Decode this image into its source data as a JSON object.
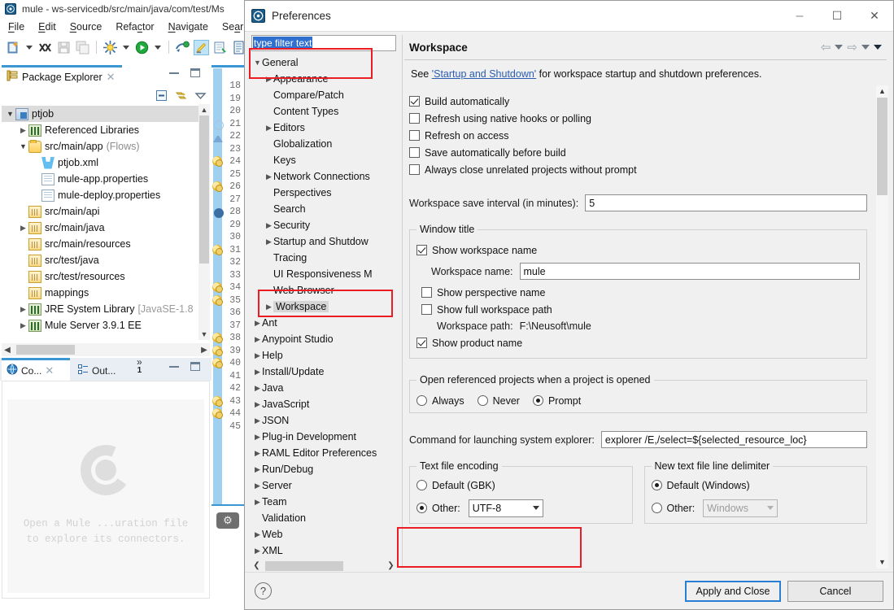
{
  "eclipse": {
    "window_title": "mule - ws-servicedb/src/main/java/com/test/Ms",
    "menu": [
      "File",
      "Edit",
      "Source",
      "Refactor",
      "Navigate",
      "Search"
    ],
    "toolbar_icons": [
      "new-wizard-icon",
      "new-wizard-dropdown",
      "link-break-icon",
      "save-icon",
      "save-all-icon",
      "debug-icon",
      "debug-dropdown",
      "run-icon",
      "run-dropdown",
      "mule-deploy-icon",
      "highlight-icon",
      "external-tools-icon",
      "open-task-icon"
    ],
    "package_explorer": {
      "tab_label": "Package Explorer",
      "tab_icon": "package-explorer-icon",
      "close_icon": "close-icon",
      "view_icons": [
        "collapse-all-icon",
        "link-with-editor-icon",
        "view-menu-icon"
      ],
      "tree": [
        {
          "label": "ptjob",
          "indent": 0,
          "twisty": "v",
          "icon": "ic-proj",
          "selected": true
        },
        {
          "label": "Referenced Libraries",
          "indent": 1,
          "twisty": ">",
          "icon": "ic-lib"
        },
        {
          "label": "src/main/app",
          "suffix": "(Flows)",
          "indent": 1,
          "twisty": "v",
          "icon": "ic-folder"
        },
        {
          "label": "ptjob.xml",
          "indent": 2,
          "twisty": "",
          "icon": "ic-mule"
        },
        {
          "label": "mule-app.properties",
          "indent": 2,
          "twisty": "",
          "icon": "ic-file"
        },
        {
          "label": "mule-deploy.properties",
          "indent": 2,
          "twisty": "",
          "icon": "ic-file"
        },
        {
          "label": "src/main/api",
          "indent": 1,
          "twisty": "",
          "icon": "ic-pkgfolder"
        },
        {
          "label": "src/main/java",
          "indent": 1,
          "twisty": ">",
          "icon": "ic-pkgfolder"
        },
        {
          "label": "src/main/resources",
          "indent": 1,
          "twisty": "",
          "icon": "ic-pkgfolder"
        },
        {
          "label": "src/test/java",
          "indent": 1,
          "twisty": "",
          "icon": "ic-pkgfolder"
        },
        {
          "label": "src/test/resources",
          "indent": 1,
          "twisty": "",
          "icon": "ic-pkgfolder"
        },
        {
          "label": "mappings",
          "indent": 1,
          "twisty": "",
          "icon": "ic-pkgfolder"
        },
        {
          "label": "JRE System Library",
          "suffix": "[JavaSE-1.8",
          "indent": 1,
          "twisty": ">",
          "icon": "ic-lib"
        },
        {
          "label": "Mule Server 3.9.1 EE",
          "indent": 1,
          "twisty": ">",
          "icon": "ic-lib"
        }
      ]
    },
    "console_view": {
      "console_tab": "Co...",
      "console_icon": "console-icon",
      "close_icon": "close-icon",
      "outline_tab": "Out...",
      "outline_icon": "outline-icon",
      "overflow_label": "1",
      "minimize_icon": "minimize-icon",
      "maximize_icon": "maximize-icon",
      "placeholder_line1": "Open a Mule ...uration file",
      "placeholder_line2": "to explore its connectors.",
      "logo": "mule-connectors-logo"
    },
    "editor_gutter": {
      "lines": [
        {
          "n": "18",
          "mark": ""
        },
        {
          "n": "19",
          "mark": ""
        },
        {
          "n": "20",
          "mark": ""
        },
        {
          "n": "21",
          "mark": "circle"
        },
        {
          "n": "22",
          "mark": "triangle"
        },
        {
          "n": "23",
          "mark": ""
        },
        {
          "n": "24",
          "mark": "warning"
        },
        {
          "n": "25",
          "mark": ""
        },
        {
          "n": "26",
          "mark": "warning"
        },
        {
          "n": "27",
          "mark": ""
        },
        {
          "n": "28",
          "mark": "breakpoint"
        },
        {
          "n": "29",
          "mark": ""
        },
        {
          "n": "30",
          "mark": ""
        },
        {
          "n": "31",
          "mark": "warning"
        },
        {
          "n": "32",
          "mark": ""
        },
        {
          "n": "33",
          "mark": ""
        },
        {
          "n": "34",
          "mark": "warning"
        },
        {
          "n": "35",
          "mark": "warning"
        },
        {
          "n": "36",
          "mark": ""
        },
        {
          "n": "37",
          "mark": ""
        },
        {
          "n": "38",
          "mark": "warning"
        },
        {
          "n": "39",
          "mark": "warning"
        },
        {
          "n": "40",
          "mark": "warning"
        },
        {
          "n": "41",
          "mark": ""
        },
        {
          "n": "42",
          "mark": ""
        },
        {
          "n": "43",
          "mark": "warning"
        },
        {
          "n": "44",
          "mark": "warning"
        },
        {
          "n": "45",
          "mark": ""
        }
      ],
      "bottom_icon": "gear-icon"
    }
  },
  "prefs": {
    "title": "Preferences",
    "icon": "preferences-app-icon",
    "window_buttons": {
      "minimize": "–",
      "maximize": "☐",
      "close": "✕"
    },
    "filter": {
      "value": "type filter text",
      "placeholder": "type filter text"
    },
    "tree": [
      {
        "label": "General",
        "indent": 0,
        "arrow": "v"
      },
      {
        "label": "Appearance",
        "indent": 1,
        "arrow": ">"
      },
      {
        "label": "Compare/Patch",
        "indent": 1,
        "arrow": ""
      },
      {
        "label": "Content Types",
        "indent": 1,
        "arrow": ""
      },
      {
        "label": "Editors",
        "indent": 1,
        "arrow": ">"
      },
      {
        "label": "Globalization",
        "indent": 1,
        "arrow": ""
      },
      {
        "label": "Keys",
        "indent": 1,
        "arrow": ""
      },
      {
        "label": "Network Connections",
        "indent": 1,
        "arrow": ">"
      },
      {
        "label": "Perspectives",
        "indent": 1,
        "arrow": ""
      },
      {
        "label": "Search",
        "indent": 1,
        "arrow": ""
      },
      {
        "label": "Security",
        "indent": 1,
        "arrow": ">"
      },
      {
        "label": "Startup and Shutdow",
        "indent": 1,
        "arrow": ">"
      },
      {
        "label": "Tracing",
        "indent": 1,
        "arrow": ""
      },
      {
        "label": "UI Responsiveness M",
        "indent": 1,
        "arrow": ""
      },
      {
        "label": "Web Browser",
        "indent": 1,
        "arrow": ""
      },
      {
        "label": "Workspace",
        "indent": 1,
        "arrow": ">",
        "selected": true
      },
      {
        "label": "Ant",
        "indent": 0,
        "arrow": ">"
      },
      {
        "label": "Anypoint Studio",
        "indent": 0,
        "arrow": ">"
      },
      {
        "label": "Help",
        "indent": 0,
        "arrow": ">"
      },
      {
        "label": "Install/Update",
        "indent": 0,
        "arrow": ">"
      },
      {
        "label": "Java",
        "indent": 0,
        "arrow": ">"
      },
      {
        "label": "JavaScript",
        "indent": 0,
        "arrow": ">"
      },
      {
        "label": "JSON",
        "indent": 0,
        "arrow": ">"
      },
      {
        "label": "Plug-in Development",
        "indent": 0,
        "arrow": ">"
      },
      {
        "label": "RAML Editor Preferences",
        "indent": 0,
        "arrow": ">"
      },
      {
        "label": "Run/Debug",
        "indent": 0,
        "arrow": ">"
      },
      {
        "label": "Server",
        "indent": 0,
        "arrow": ">"
      },
      {
        "label": "Team",
        "indent": 0,
        "arrow": ">"
      },
      {
        "label": "Validation",
        "indent": 0,
        "arrow": ""
      },
      {
        "label": "Web",
        "indent": 0,
        "arrow": ">"
      },
      {
        "label": "XML",
        "indent": 0,
        "arrow": ">"
      }
    ],
    "pane": {
      "heading": "Workspace",
      "nav_icons": [
        "back-arrow-icon",
        "back-dropdown-icon",
        "forward-arrow-icon",
        "forward-dropdown-icon",
        "view-menu-icon"
      ],
      "see_prefix": "See ",
      "see_link": "'Startup and Shutdown'",
      "see_suffix": " for workspace startup and shutdown preferences.",
      "checkboxes": [
        {
          "label": "Build automatically",
          "checked": true
        },
        {
          "label": "Refresh using native hooks or polling",
          "checked": false
        },
        {
          "label": "Refresh on access",
          "checked": false
        },
        {
          "label": "Save automatically before build",
          "checked": false
        },
        {
          "label": "Always close unrelated projects without prompt",
          "checked": false
        }
      ],
      "save_interval_label": "Workspace save interval (in minutes):",
      "save_interval_value": "5",
      "window_title_group": {
        "title": "Window title",
        "show_workspace_name": {
          "label": "Show workspace name",
          "checked": true
        },
        "workspace_name_label": "Workspace name:",
        "workspace_name_value": "mule",
        "show_perspective_name": {
          "label": "Show perspective name",
          "checked": false
        },
        "show_full_workspace_path": {
          "label": "Show full workspace path",
          "checked": false
        },
        "workspace_path_label": "Workspace path:",
        "workspace_path_value": "F:\\Neusoft\\mule",
        "show_product_name": {
          "label": "Show product name",
          "checked": true
        }
      },
      "open_referenced_group": {
        "title": "Open referenced projects when a project is opened",
        "options": [
          {
            "label": "Always",
            "selected": false
          },
          {
            "label": "Never",
            "selected": false
          },
          {
            "label": "Prompt",
            "selected": true
          }
        ]
      },
      "command_label": "Command for launching system explorer:",
      "command_value": "explorer /E,/select=${selected_resource_loc}",
      "text_file_encoding": {
        "title": "Text file encoding",
        "default_label": "Default (GBK)",
        "default_selected": false,
        "other_label": "Other:",
        "other_selected": true,
        "other_value": "UTF-8"
      },
      "line_delimiter": {
        "title": "New text file line delimiter",
        "default_label": "Default (Windows)",
        "default_selected": true,
        "other_label": "Other:",
        "other_selected": false,
        "other_value": "Windows",
        "other_disabled": true
      }
    },
    "footer": {
      "help_icon": "help-icon",
      "apply_label": "Apply and Close",
      "cancel_label": "Cancel"
    },
    "highlight_color": "#ec1c24"
  }
}
